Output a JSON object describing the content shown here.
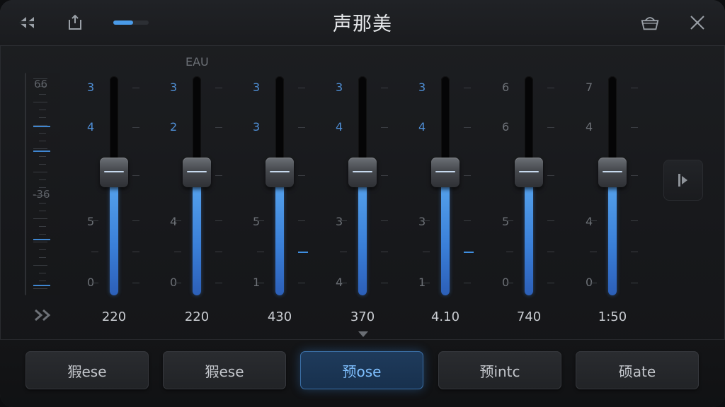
{
  "window": {
    "title": "声那美"
  },
  "header": {
    "mini_level": 0.55
  },
  "section_label": "EAU",
  "meter": {
    "top_label": "66",
    "mid_label": "-36"
  },
  "sliders": [
    {
      "scale": [
        "3",
        "4",
        "5",
        "",
        "0"
      ],
      "freq": "220",
      "value": 0.56
    },
    {
      "scale": [
        "3",
        "2",
        "4",
        "",
        "0"
      ],
      "freq": "220",
      "value": 0.56
    },
    {
      "scale": [
        "3",
        "3",
        "5",
        "",
        "1"
      ],
      "freq": "430",
      "value": 0.56
    },
    {
      "scale": [
        "3",
        "4",
        "3",
        "",
        "4"
      ],
      "freq": "370",
      "value": 0.56
    },
    {
      "scale": [
        "3",
        "4",
        "3",
        "",
        "1"
      ],
      "freq": "4.10",
      "value": 0.56
    },
    {
      "scale": [
        "6",
        "6",
        "5",
        "",
        "0"
      ],
      "freq": "740",
      "value": 0.56
    },
    {
      "scale": [
        "7",
        "4",
        "4",
        "",
        "0"
      ],
      "freq": "1:50",
      "value": 0.56
    }
  ],
  "presets": [
    {
      "label": "猳ese",
      "active": false
    },
    {
      "label": "猳ese",
      "active": false
    },
    {
      "label": "预ose",
      "active": true
    },
    {
      "label": "预intc",
      "active": false
    },
    {
      "label": "硕ate",
      "active": false
    }
  ],
  "colors": {
    "accent": "#4a9be8",
    "scale_blue": "#4f8fd6",
    "scale_gray": "#6d7177"
  },
  "icons": {
    "rewind": "rewind-icon",
    "power": "power-icon",
    "basket": "basket-icon",
    "close": "close-icon",
    "play": "play-icon",
    "forward": "fast-forward-icon"
  }
}
